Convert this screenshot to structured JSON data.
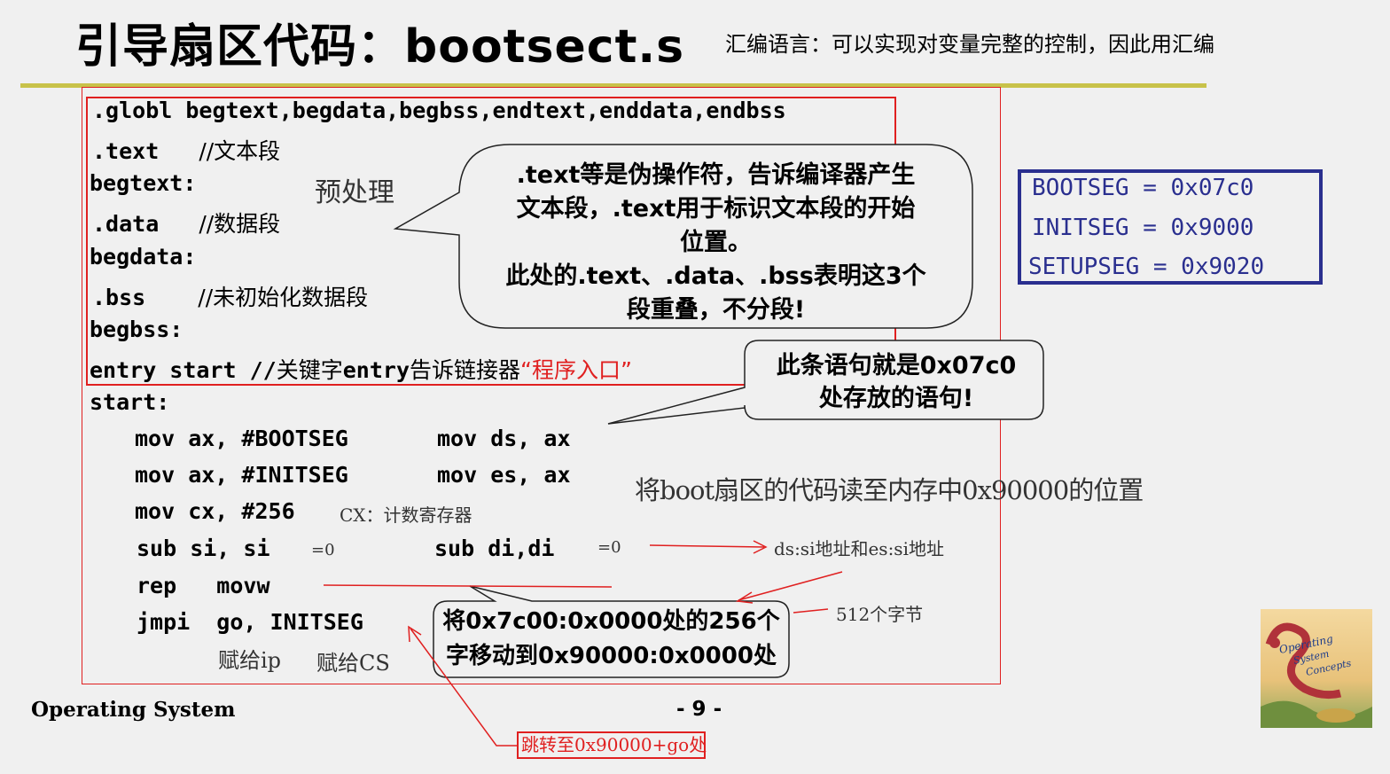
{
  "title": "引导扇区代码：bootsect.s",
  "subtitle": "汇编语言：可以实现对变量完整的控制，因此用汇编",
  "code": {
    "l1": ".globl begtext,begdata,begbss,endtext,enddata,endbss",
    "l2_code": ".text",
    "l2_cmt": "//文本段",
    "l3": "begtext:",
    "l4_code": ".data",
    "l4_cmt": "//数据段",
    "l5": "begdata:",
    "l6_code": ".bss",
    "l6_cmt": "//未初始化数据段",
    "l7": "begbss:",
    "l8_code": "entry start //",
    "l8_cmt1": "关键字",
    "l8_code2": "entry",
    "l8_cmt2": "告诉链接器",
    "l8_red": "“程序入口”",
    "l9": "start:",
    "i1a": "mov ax, #BOOTSEG",
    "i1b": "mov ds, ax",
    "i2a": "mov ax, #INITSEG",
    "i2b": "mov es, ax",
    "i3a": "mov cx, #256",
    "i3note": "CX：计数寄存器",
    "i4a": "sub si, si",
    "i4note": "=0",
    "i4b": "sub di,di",
    "i4bnote": "=0",
    "i5": "rep   movw",
    "i6": "jmpi  go, INITSEG",
    "ip_note": "赋给ip",
    "cs_note": "赋给CS"
  },
  "notes": {
    "preprocess": "预处理",
    "bubble1_lines": [
      ".text等是伪操作符，告诉编译器产生",
      "文本段，.text用于标识文本段的开始",
      "位置。",
      "此处的.text、.data、.bss表明这3个",
      "段重叠，不分段!"
    ],
    "bubble2_lines": [
      "此条语句就是0x07c0",
      "处存放的语句!"
    ],
    "bubble3_lines": [
      "将0x7c00:0x0000处的256个",
      "字移动到0x90000:0x0000处"
    ],
    "read_note": "将boot扇区的代码读至内存中0x90000的位置",
    "addr_note": "ds:si地址和es:si地址",
    "bytes_note": "512个字节",
    "jump_note": "跳转至0x90000+go处"
  },
  "segments": {
    "bootseg": "BOOTSEG = 0x07c0",
    "initseg": "INITSEG = 0x9000",
    "setupseg": "SETUPSEG = 0x9020"
  },
  "footer": {
    "left": "Operating System",
    "page": "- 9 -"
  },
  "book": {
    "line1": "Operating",
    "line2": "System",
    "line3": "Concepts"
  },
  "colors": {
    "accent_red": "#e02020",
    "seg_blue": "#2a2f8f",
    "rule_olive": "#c8c24a"
  }
}
